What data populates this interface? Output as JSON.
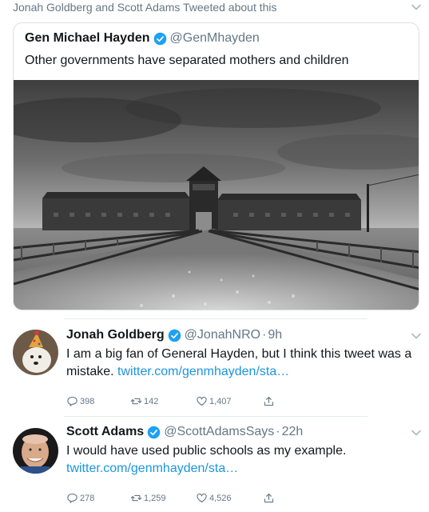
{
  "header": {
    "text": "Jonah Goldberg and Scott Adams Tweeted about this",
    "chevron_icon": "chevron-down-icon"
  },
  "quoted_tweet": {
    "name": "Gen Michael Hayden",
    "handle": "@GenMhayden",
    "verified": true,
    "text": "Other governments have separated mothers and children",
    "media": "photo"
  },
  "replies": [
    {
      "name": "Jonah Goldberg",
      "handle": "@JonahNRO",
      "sep": "·",
      "time": "9h",
      "verified": true,
      "text": "I am a big fan of General Hayden, but I think this tweet was a mistake.",
      "link": "twitter.com/genmhayden/sta…",
      "reply_count": "398",
      "retweet_count": "142",
      "like_count": "1,407"
    },
    {
      "name": "Scott Adams",
      "handle": "@ScottAdamsSays",
      "sep": "·",
      "time": "22h",
      "verified": true,
      "text": "I would have used public schools as my example.",
      "link": "twitter.com/genmhayden/sta…",
      "reply_count": "278",
      "retweet_count": "1,259",
      "like_count": "4,526"
    }
  ],
  "colors": {
    "link": "#1b95e0",
    "verified": "#1da1f2",
    "muted": "#657786",
    "text": "#14171a"
  }
}
